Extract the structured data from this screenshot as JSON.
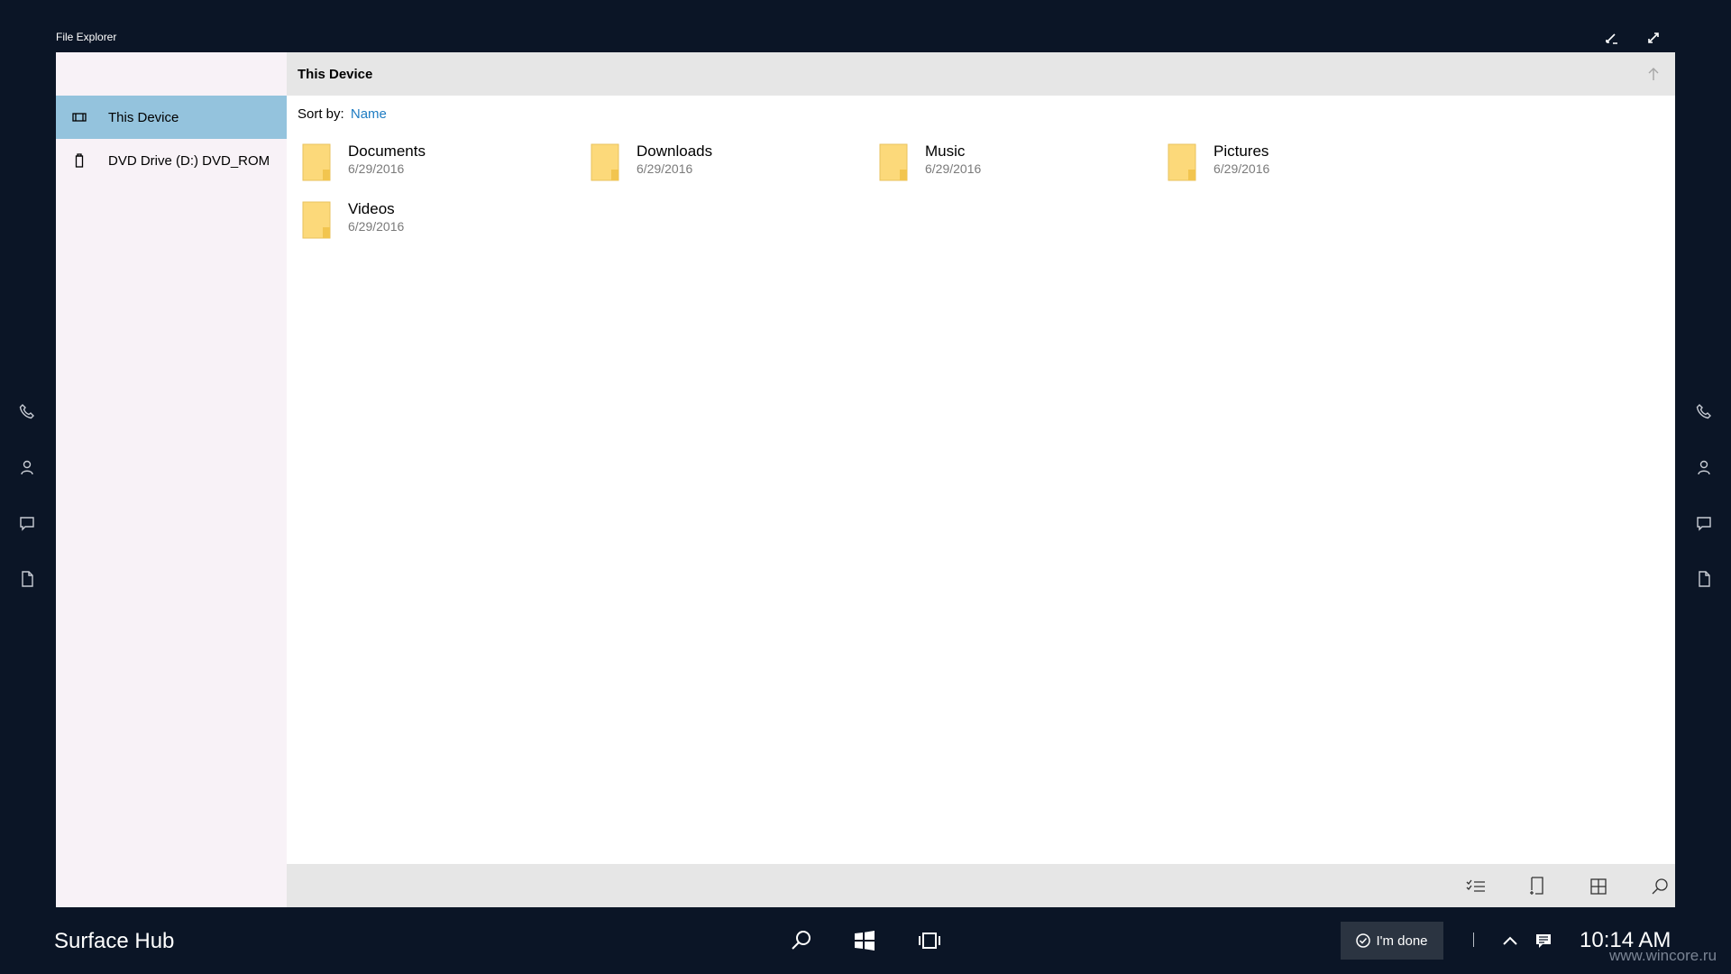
{
  "window": {
    "title": "File Explorer"
  },
  "nav": {
    "items": [
      {
        "label": "This Device",
        "icon": "device-icon",
        "selected": true
      },
      {
        "label": "DVD Drive (D:) DVD_ROM",
        "icon": "dvd-drive-icon",
        "selected": false
      }
    ]
  },
  "header": {
    "title": "This Device"
  },
  "sort": {
    "label": "Sort by:",
    "value": "Name"
  },
  "items": [
    {
      "name": "Documents",
      "date": "6/29/2016"
    },
    {
      "name": "Downloads",
      "date": "6/29/2016"
    },
    {
      "name": "Music",
      "date": "6/29/2016"
    },
    {
      "name": "Pictures",
      "date": "6/29/2016"
    },
    {
      "name": "Videos",
      "date": "6/29/2016"
    }
  ],
  "bottom_bar": {
    "more_label": "···",
    "icons": [
      "select-list-icon",
      "new-folder-icon",
      "grid-view-icon",
      "search-icon",
      "more-icon"
    ]
  },
  "taskbar": {
    "hub_name": "Surface Hub",
    "done_label": "I'm done",
    "clock": "10:14 AM"
  },
  "watermark": "www.wincore.ru",
  "colors": {
    "desktop": "#0b1526",
    "nav_selected": "#94c3dd",
    "nav_pane": "#f8f2f7",
    "accent_link": "#1e7cc2",
    "folder": "#fcd97a"
  }
}
